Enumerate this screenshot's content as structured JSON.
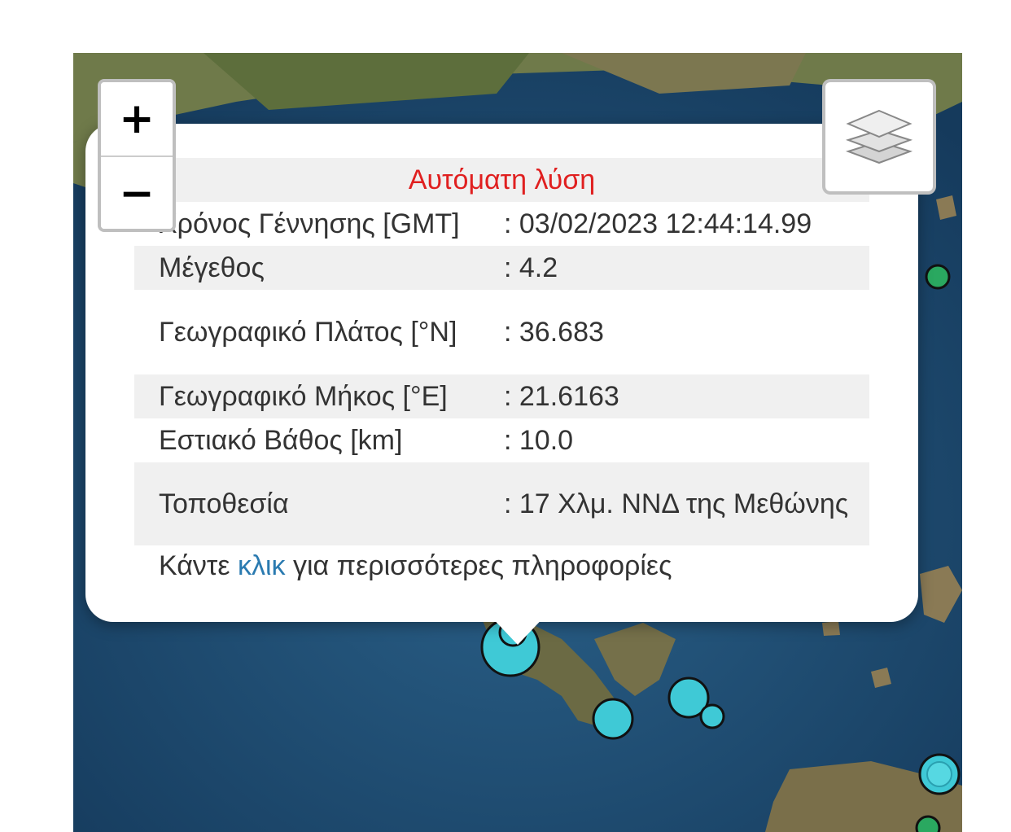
{
  "zoom": {
    "in_label": "+",
    "out_label": "−"
  },
  "layers": {
    "icon": "layers-icon"
  },
  "popup": {
    "title": "Αυτόματη λύση",
    "rows": [
      {
        "label": "Χρόνος Γέννησης [GMT]",
        "value": ": 03/02/2023 12:44:14.99"
      },
      {
        "label": "Μέγεθος",
        "value": ": 4.2"
      },
      {
        "label": "Γεωγραφικό Πλάτος [°N]",
        "value": ": 36.683"
      },
      {
        "label": "Γεωγραφικό Μήκος [°E]",
        "value": ": 21.6163"
      },
      {
        "label": "Εστιακό Βάθος [km]",
        "value": ": 10.0"
      },
      {
        "label": "Τοποθεσία",
        "value": ": 17 Χλμ. ΝΝΔ της Μεθώνης"
      }
    ],
    "more_prefix": "Κάντε",
    "more_link": "κλικ",
    "more_suffix": "για περισσότερες πληροφορίες"
  },
  "colors": {
    "title": "#e02020",
    "link": "#2a7ab0",
    "marker_cyan": "#3fc9d6",
    "marker_green": "#2aa860",
    "sea": "#1e4d73"
  },
  "markers": [
    {
      "kind": "earthquake",
      "color": "cyan"
    },
    {
      "kind": "earthquake",
      "color": "cyan"
    },
    {
      "kind": "earthquake",
      "color": "cyan"
    },
    {
      "kind": "earthquake",
      "color": "cyan"
    },
    {
      "kind": "earthquake",
      "color": "cyan"
    },
    {
      "kind": "earthquake",
      "color": "green"
    },
    {
      "kind": "earthquake",
      "color": "green"
    }
  ]
}
